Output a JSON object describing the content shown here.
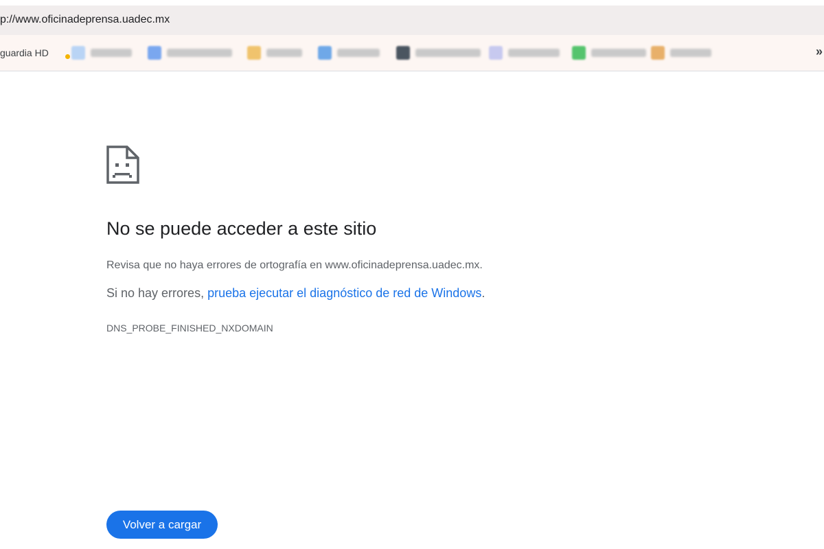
{
  "browser": {
    "url": "p://www.oficinadeprensa.uadec.mx",
    "bookmarks": [
      {
        "label": "guardia HD",
        "icon": "bookmark-favicon"
      },
      {
        "label": "",
        "icon": "blurred-favicon"
      },
      {
        "label": "",
        "icon": "blurred-favicon"
      },
      {
        "label": "",
        "icon": "blurred-favicon"
      },
      {
        "label": "",
        "icon": "blurred-favicon"
      },
      {
        "label": "",
        "icon": "blurred-favicon"
      },
      {
        "label": "",
        "icon": "blurred-favicon"
      },
      {
        "label": "",
        "icon": "blurred-favicon"
      },
      {
        "label": "",
        "icon": "blurred-favicon"
      }
    ],
    "overflow_label": "»"
  },
  "error": {
    "icon": "sad-page-icon",
    "title": "No se puede acceder a este sitio",
    "line1": "Revisa que no haya errores de ortografía en www.oficinadeprensa.uadec.mx.",
    "line2_prefix": "Si no hay errores, ",
    "line2_link": "prueba ejecutar el diagnóstico de red de Windows",
    "line2_suffix": ".",
    "code": "DNS_PROBE_FINISHED_NXDOMAIN",
    "reload_label": "Volver a cargar"
  },
  "colors": {
    "accent": "#1a73e8",
    "text_primary": "#202124",
    "text_secondary": "#5f6368"
  }
}
